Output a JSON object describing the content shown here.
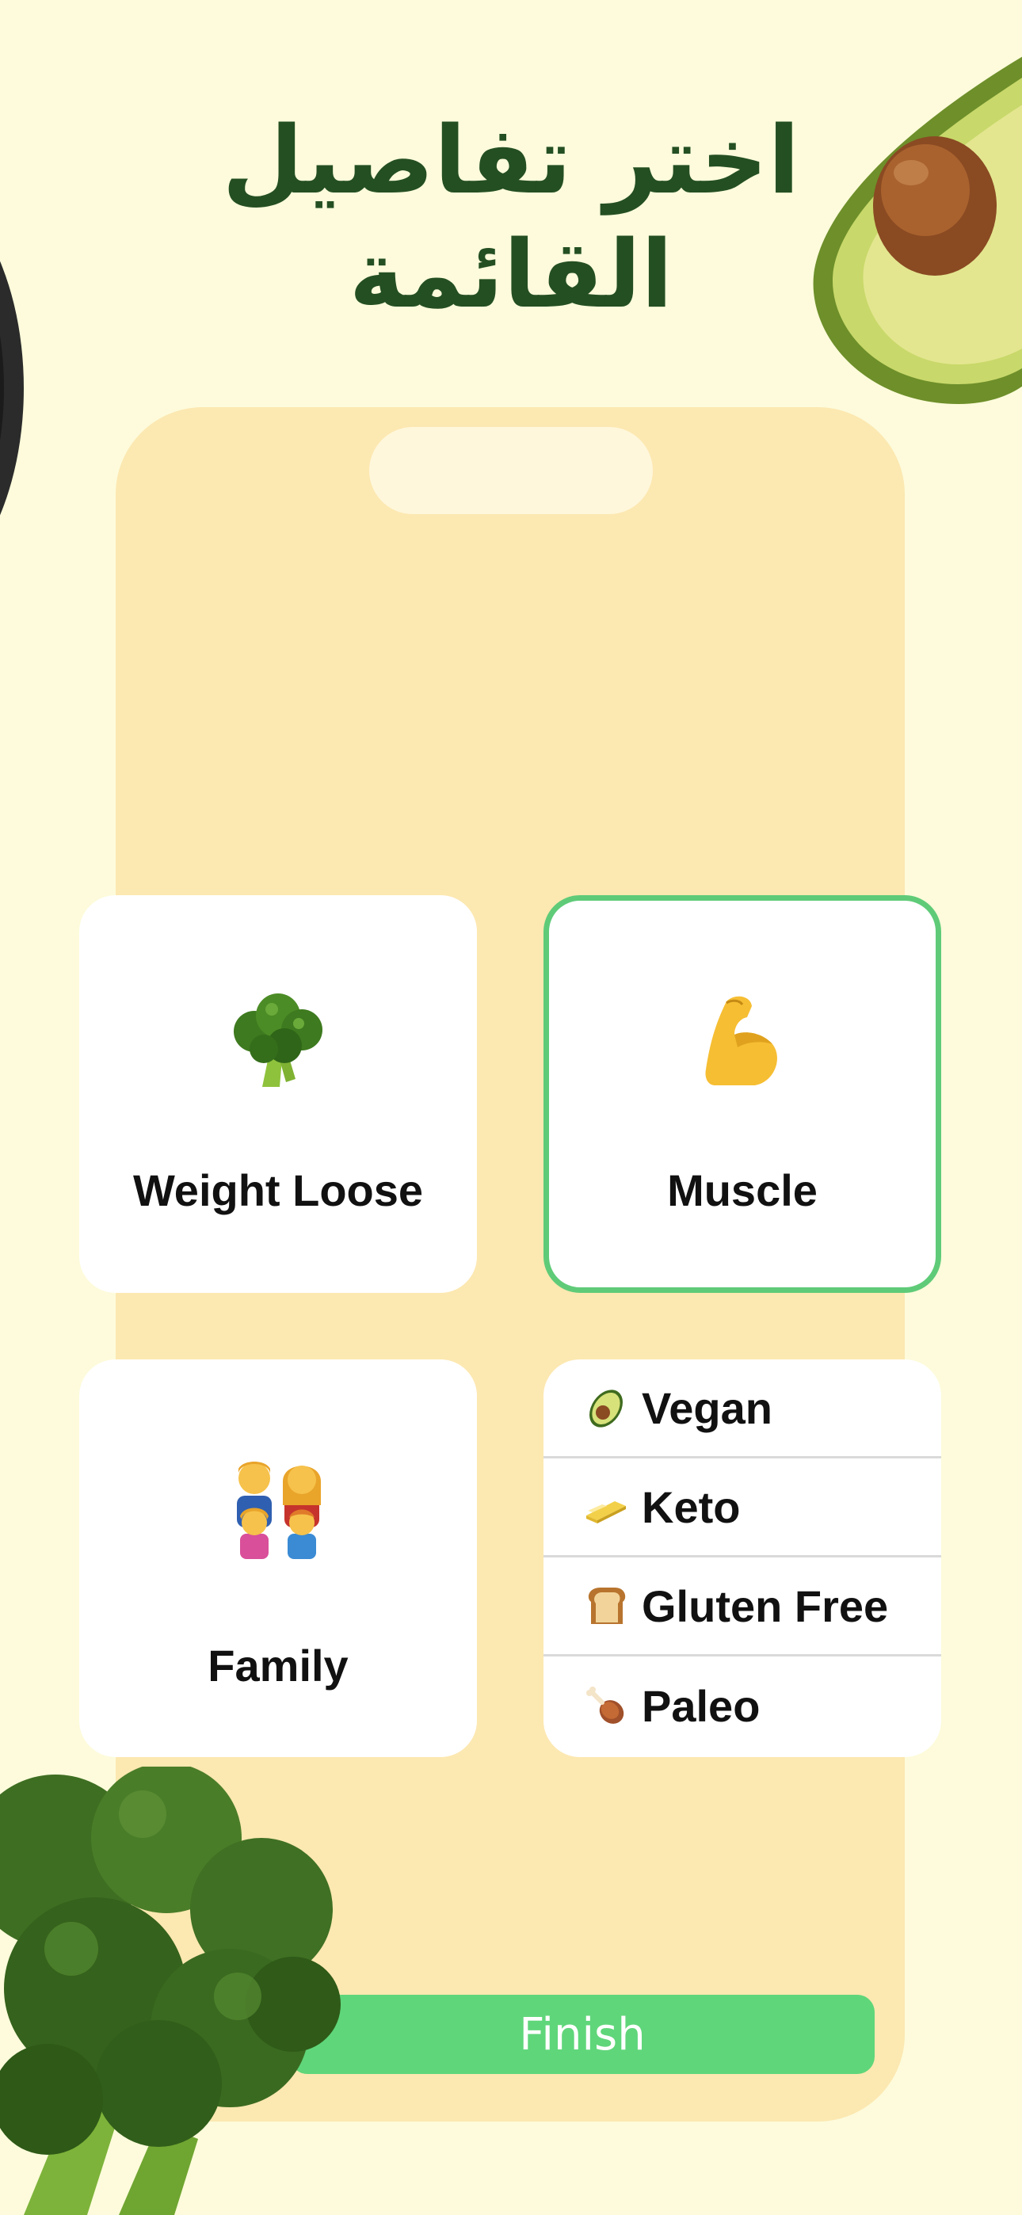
{
  "headline": {
    "line1": "اختر تفاصيل",
    "line2": "القائمة"
  },
  "goals": [
    {
      "label": "Weight Loose",
      "icon": "broccoli-icon",
      "selected": false
    },
    {
      "label": "Muscle",
      "icon": "flexed-biceps-icon",
      "selected": true
    },
    {
      "label": "Family",
      "icon": "family-icon",
      "selected": false
    }
  ],
  "diets": [
    {
      "label": "Vegan",
      "icon": "avocado-icon"
    },
    {
      "label": "Keto",
      "icon": "butter-icon"
    },
    {
      "label": "Gluten Free",
      "icon": "bread-icon"
    },
    {
      "label": "Paleo",
      "icon": "poultry-leg-icon"
    }
  ],
  "finish_button": {
    "label": "Finish"
  },
  "colors": {
    "background": "#FDFBDB",
    "phone_frame": "#FCE8B1",
    "headline": "#244F23",
    "accent_green": "#5FD67A",
    "selected_border": "#5FCB78"
  }
}
